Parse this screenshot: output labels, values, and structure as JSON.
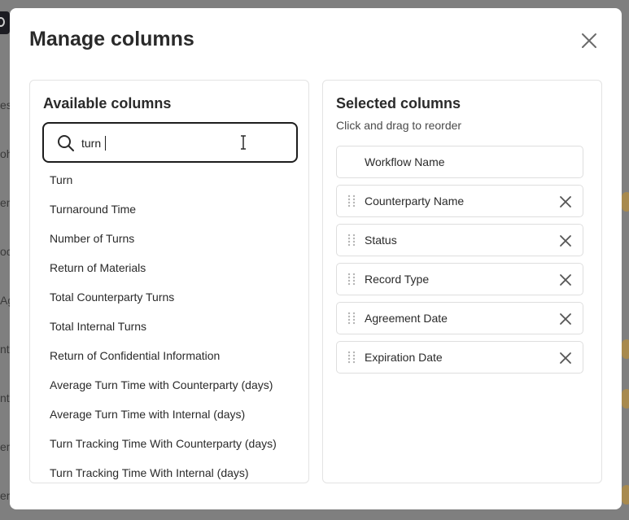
{
  "background": {
    "fragments": [
      "es",
      "oh",
      "en",
      "oc",
      "Ag",
      "nt",
      "nt",
      "em",
      "em"
    ]
  },
  "modal": {
    "title": "Manage columns",
    "close_icon": "close-icon"
  },
  "available": {
    "title": "Available columns",
    "search": {
      "value": "turn",
      "icon": "search-icon"
    },
    "items": [
      "Turn",
      "Turnaround Time",
      "Number of Turns",
      "Return of Materials",
      "Total Counterparty Turns",
      "Total Internal Turns",
      "Return of Confidential Information",
      "Average Turn Time with Counterparty (days)",
      "Average Turn Time with Internal (days)",
      "Turn Tracking Time With Counterparty (days)",
      "Turn Tracking Time With Internal (days)"
    ]
  },
  "selected": {
    "title": "Selected columns",
    "subtitle": "Click and drag to reorder",
    "fixed_item": "Workflow Name",
    "items": [
      "Counterparty Name",
      "Status",
      "Record Type",
      "Agreement Date",
      "Expiration Date"
    ]
  },
  "colors": {
    "overlay": "#7f7f7f",
    "search_border": "#1d1d1d",
    "panel_border": "#e3e3e3",
    "icon_gray": "#6b6b6b"
  }
}
